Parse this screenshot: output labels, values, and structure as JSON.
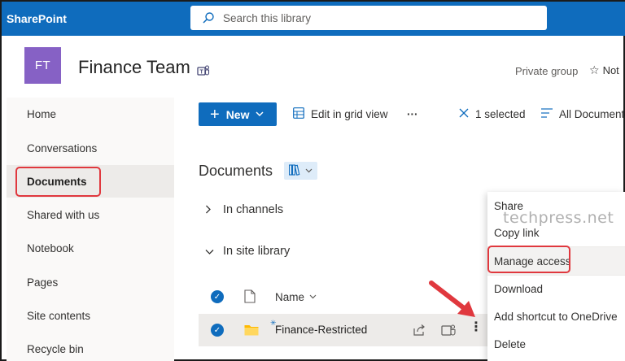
{
  "suitebar": {
    "brand": "SharePoint",
    "search_placeholder": "Search this library"
  },
  "site": {
    "logo_initials": "FT",
    "title": "Finance Team",
    "private_group": "Private group",
    "follow_label": "Not"
  },
  "nav": {
    "items": [
      {
        "label": "Home"
      },
      {
        "label": "Conversations"
      },
      {
        "label": "Documents"
      },
      {
        "label": "Shared with us"
      },
      {
        "label": "Notebook"
      },
      {
        "label": "Pages"
      },
      {
        "label": "Site contents"
      },
      {
        "label": "Recycle bin"
      }
    ]
  },
  "commandbar": {
    "new_label": "New",
    "edit_grid_label": "Edit in grid view",
    "more_label": "···",
    "selected_label": "1 selected",
    "all_documents_label": "All Documents"
  },
  "library": {
    "title": "Documents",
    "groups": [
      {
        "label": "In channels"
      },
      {
        "label": "In site library"
      }
    ],
    "column_name": "Name",
    "rows": [
      {
        "name": "Finance-Restricted"
      }
    ]
  },
  "context_menu": {
    "items": [
      {
        "label": "Share"
      },
      {
        "label": "Copy link"
      },
      {
        "label": "Manage access"
      },
      {
        "label": "Download"
      },
      {
        "label": "Add shortcut to OneDrive"
      },
      {
        "label": "Delete"
      }
    ]
  },
  "watermark": "techpress.net",
  "colors": {
    "suite_blue": "#0f6cbd",
    "site_logo": "#8661c5",
    "highlight_red": "#e0383e"
  }
}
